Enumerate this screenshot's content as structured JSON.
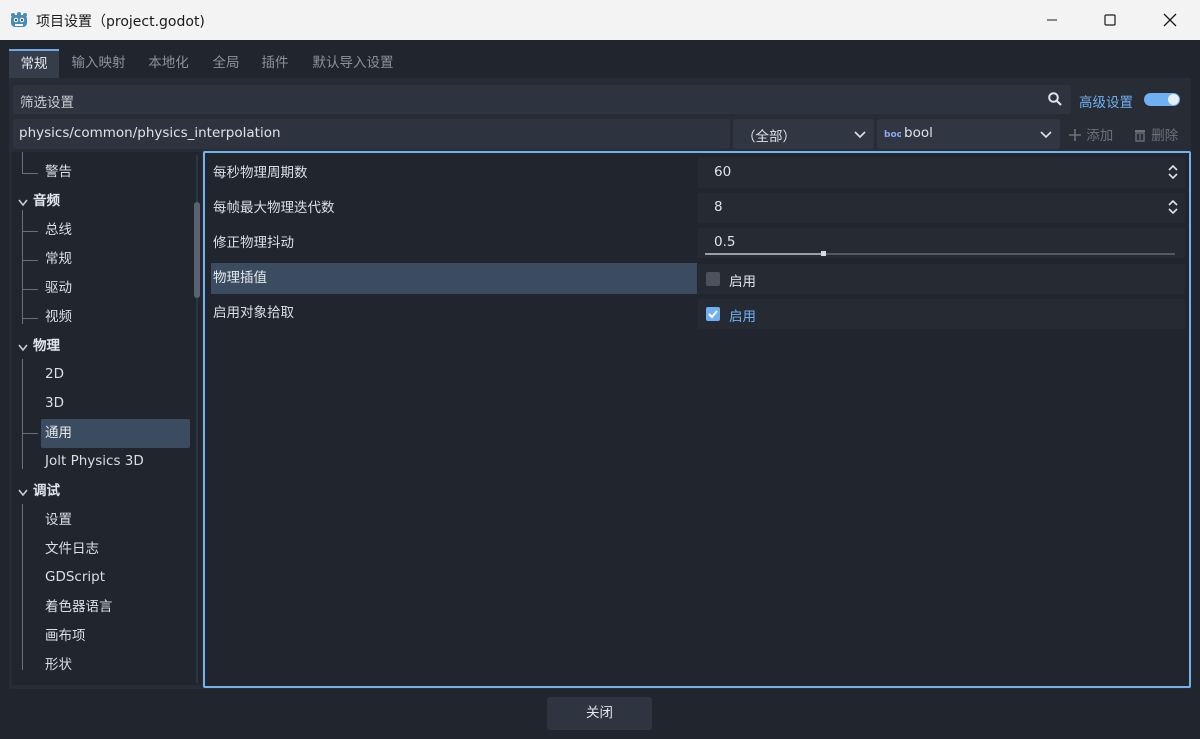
{
  "window": {
    "title": "项目设置（project.godot)",
    "icon": "godot-icon",
    "controls": [
      "minimize-icon",
      "maximize-icon",
      "close-icon"
    ]
  },
  "tabs": [
    {
      "label": "常规",
      "active": true
    },
    {
      "label": "输入映射"
    },
    {
      "label": "本地化"
    },
    {
      "label": "全局"
    },
    {
      "label": "插件"
    },
    {
      "label": "默认导入设置"
    }
  ],
  "filter": {
    "placeholder": "筛选设置",
    "advanced_label": "高级设置",
    "advanced_on": true
  },
  "path_row": {
    "path": "physics/common/physics_interpolation",
    "scope": "（全部）",
    "type": "bool",
    "type_icon": "bool-type-icon",
    "add_label": "添加",
    "delete_label": "删除"
  },
  "sidebar": {
    "items": [
      {
        "label": "警告",
        "kind": "leaf"
      },
      {
        "label": "音频",
        "kind": "category"
      },
      {
        "label": "总线",
        "kind": "leaf"
      },
      {
        "label": "常规",
        "kind": "leaf"
      },
      {
        "label": "驱动",
        "kind": "leaf"
      },
      {
        "label": "视频",
        "kind": "leaf"
      },
      {
        "label": "物理",
        "kind": "category"
      },
      {
        "label": "2D",
        "kind": "leaf"
      },
      {
        "label": "3D",
        "kind": "leaf"
      },
      {
        "label": "通用",
        "kind": "leaf",
        "selected": true
      },
      {
        "label": "Jolt Physics 3D",
        "kind": "leaf"
      },
      {
        "label": "调试",
        "kind": "category"
      },
      {
        "label": "设置",
        "kind": "leaf"
      },
      {
        "label": "文件日志",
        "kind": "leaf"
      },
      {
        "label": "GDScript",
        "kind": "leaf"
      },
      {
        "label": "着色器语言",
        "kind": "leaf"
      },
      {
        "label": "画布项",
        "kind": "leaf"
      },
      {
        "label": "形状",
        "kind": "leaf"
      }
    ]
  },
  "properties": [
    {
      "name": "每秒物理周期数",
      "value": "60",
      "editor": "spin"
    },
    {
      "name": "每帧最大物理迭代数",
      "value": "8",
      "editor": "spin"
    },
    {
      "name": "修正物理抖动",
      "value": "0.5",
      "editor": "slider",
      "slider_fraction": 0.25
    },
    {
      "name": "物理插值",
      "value": "启用",
      "editor": "checkbox",
      "checked": false,
      "selected": true
    },
    {
      "name": "启用对象拾取",
      "value": "启用",
      "editor": "checkbox",
      "checked": true
    }
  ],
  "footer": {
    "close_label": "关闭"
  },
  "colors": {
    "accent": "#6fb0f2",
    "selection": "#3b4b60",
    "background": "#21252d"
  }
}
